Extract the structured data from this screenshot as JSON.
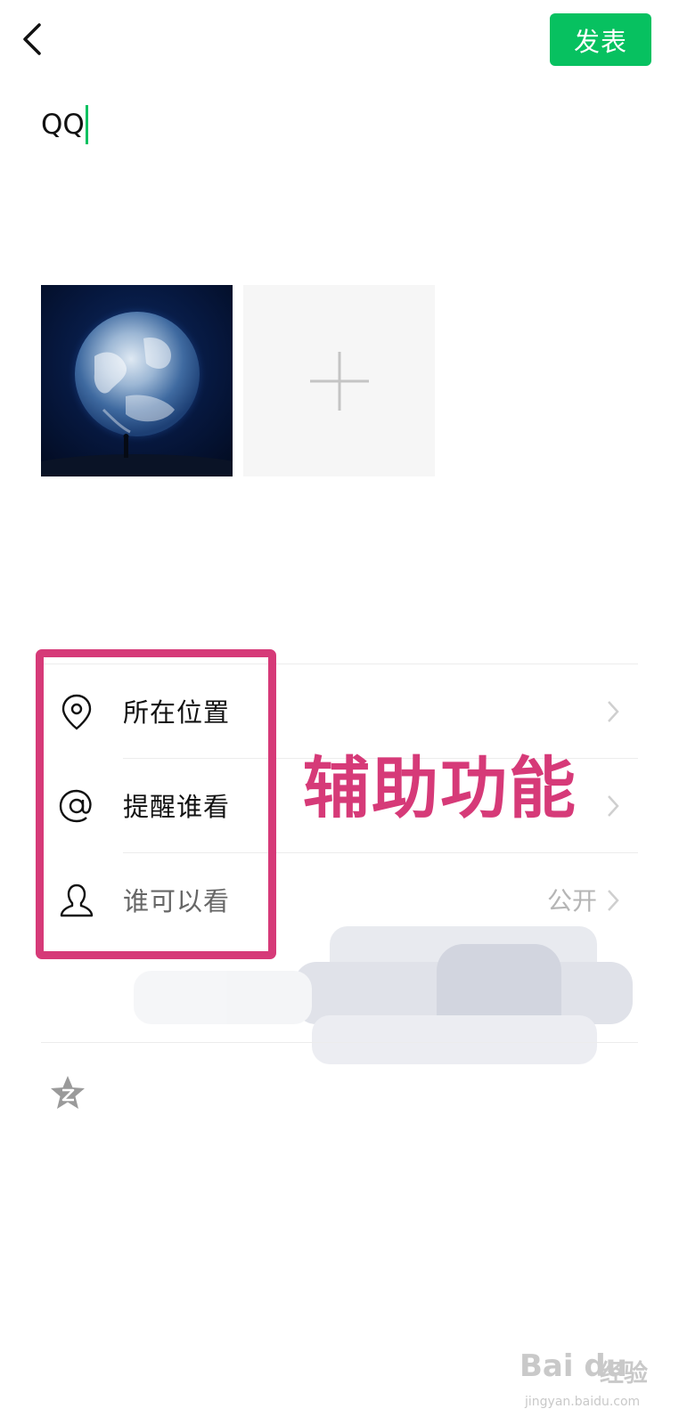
{
  "header": {
    "back_icon": "chevron-left-icon",
    "post_label": "发表",
    "accent_color": "#07c160"
  },
  "composer": {
    "text_value": "QQ"
  },
  "photos": {
    "items": [
      {
        "icon": "earth-photo"
      }
    ],
    "add_icon": "plus-icon"
  },
  "options": [
    {
      "icon": "location-pin-icon",
      "label": "所在位置",
      "value": ""
    },
    {
      "icon": "at-sign-icon",
      "label": "提醒谁看",
      "value": ""
    },
    {
      "icon": "person-icon",
      "label": "谁可以看",
      "value": "公开"
    }
  ],
  "annotation": {
    "text": "辅助功能",
    "color": "#d63a78"
  },
  "extra": {
    "icon": "qzone-star-icon"
  },
  "watermark": {
    "logo": "Bai du",
    "brand": "经验",
    "url": "jingyan.baidu.com"
  }
}
